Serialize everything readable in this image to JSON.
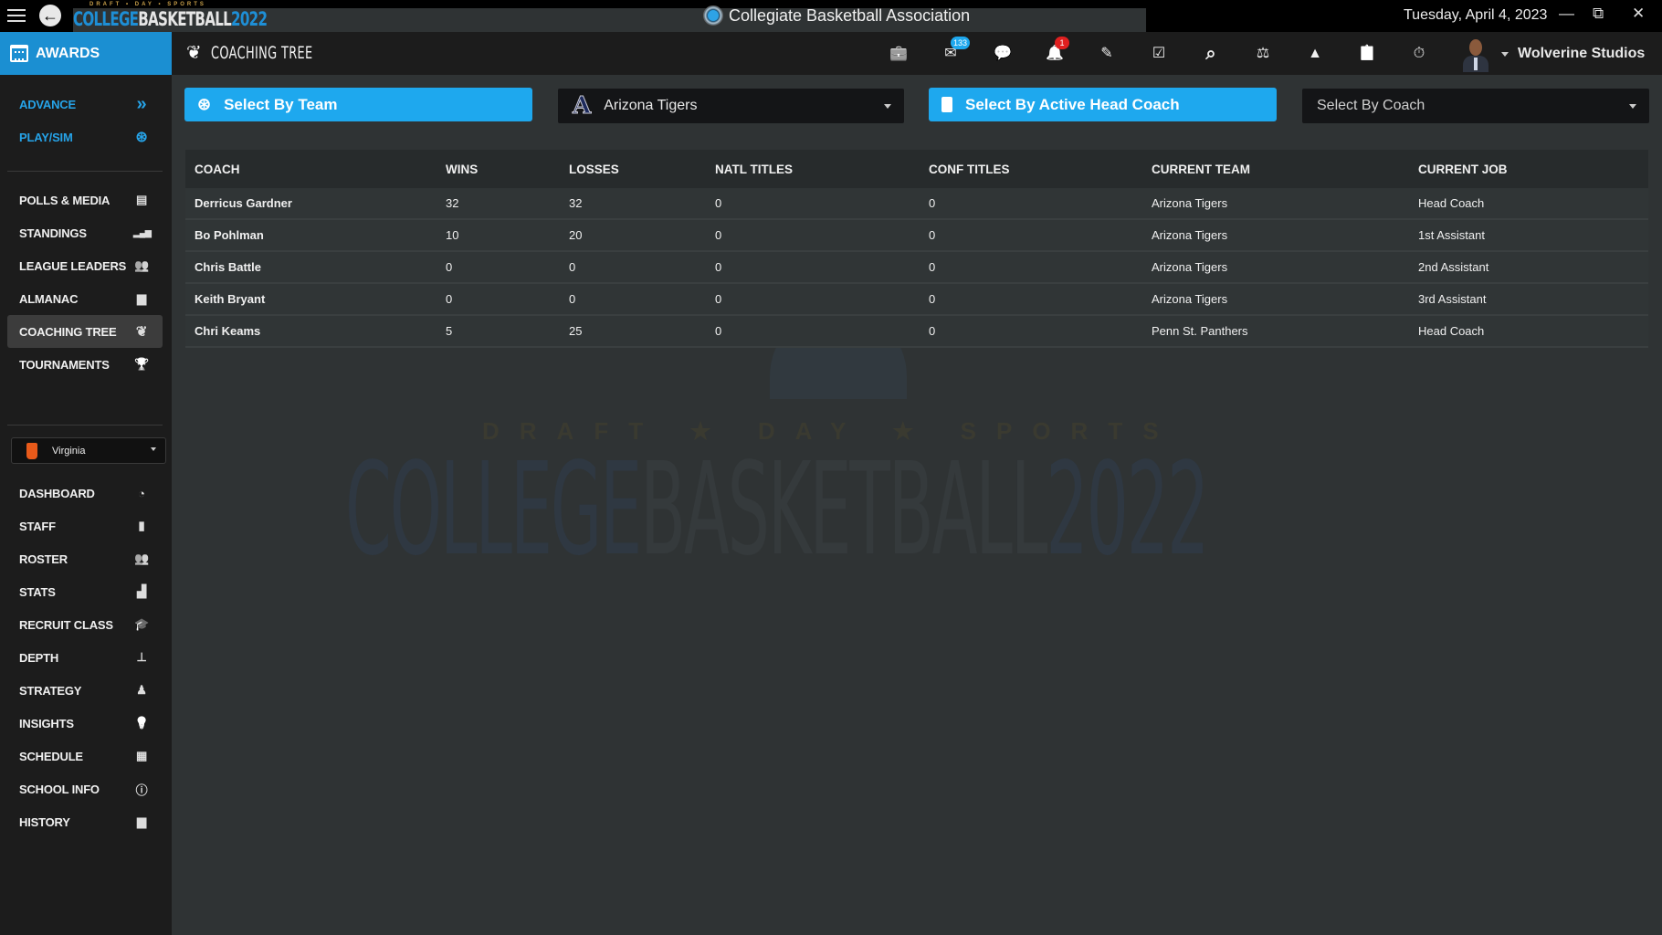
{
  "titlebar": {
    "logo_top": "DRAFT • DAY • SPORTS",
    "logo_college": "COLLEGE",
    "logo_basketball": "BASKETBALL",
    "logo_year": "2022",
    "app_title": "Collegiate Basketball Association",
    "date": "Tuesday, April 4, 2023",
    "minimize": "—",
    "restore": "⧉",
    "close": "✕"
  },
  "sidebar": {
    "awards_label": "AWARDS",
    "top_items": [
      {
        "label": "ADVANCE",
        "icon": "double-chevron-right-icon",
        "glyph": "»"
      },
      {
        "label": "PLAY/SIM",
        "icon": "basketball-icon",
        "glyph": "⊛"
      }
    ],
    "league_items": [
      {
        "label": "POLLS & MEDIA",
        "icon": "newspaper-icon",
        "glyph": "▤"
      },
      {
        "label": "STANDINGS",
        "icon": "signal-bars-icon",
        "glyph": "▂▄▆"
      },
      {
        "label": "LEAGUE LEADERS",
        "icon": "users-icon",
        "glyph": "👥"
      },
      {
        "label": "ALMANAC",
        "icon": "archive-icon",
        "glyph": "▆"
      },
      {
        "label": "COACHING TREE",
        "icon": "leaf-icon",
        "glyph": "❦",
        "active": true
      },
      {
        "label": "TOURNAMENTS",
        "icon": "trophy-icon",
        "glyph": "🏆"
      }
    ],
    "team_select": "Virginia",
    "team_items": [
      {
        "label": "DASHBOARD",
        "icon": "gauge-icon",
        "glyph": "◔"
      },
      {
        "label": "STAFF",
        "icon": "clipboard-icon",
        "glyph": "▮"
      },
      {
        "label": "ROSTER",
        "icon": "group-icon",
        "glyph": "👥"
      },
      {
        "label": "STATS",
        "icon": "bar-chart-icon",
        "glyph": "▟"
      },
      {
        "label": "RECRUIT CLASS",
        "icon": "graduate-icon",
        "glyph": "🎓"
      },
      {
        "label": "DEPTH",
        "icon": "sitemap-icon",
        "glyph": "⊥"
      },
      {
        "label": "STRATEGY",
        "icon": "chess-icon",
        "glyph": "♟"
      },
      {
        "label": "INSIGHTS",
        "icon": "lightbulb-icon",
        "glyph": "💡"
      },
      {
        "label": "SCHEDULE",
        "icon": "calendar-icon",
        "glyph": "▦"
      },
      {
        "label": "SCHOOL INFO",
        "icon": "info-icon",
        "glyph": "ⓘ"
      },
      {
        "label": "HISTORY",
        "icon": "archive-icon",
        "glyph": "▆"
      }
    ]
  },
  "topbar": {
    "page_title": "COACHING TREE",
    "icons": [
      {
        "name": "briefcase-icon",
        "glyph": "💼"
      },
      {
        "name": "mail-icon",
        "glyph": "✉",
        "badge": "133",
        "badge_color": "#1ea8ee"
      },
      {
        "name": "chat-icon",
        "glyph": "💬"
      },
      {
        "name": "bell-icon",
        "glyph": "🔔",
        "badge": "1",
        "badge_color": "#e02020"
      },
      {
        "name": "edit-icon",
        "glyph": "✎"
      },
      {
        "name": "calendar-check-icon",
        "glyph": "☑"
      },
      {
        "name": "search-icon",
        "glyph": "⌕"
      },
      {
        "name": "balance-scale-icon",
        "glyph": "⚖"
      },
      {
        "name": "road-icon",
        "glyph": "▲"
      },
      {
        "name": "clipboard-list-icon",
        "glyph": "📋"
      },
      {
        "name": "stopwatch-icon",
        "glyph": "⏱"
      }
    ],
    "user_name": "Wolverine Studios"
  },
  "filters": {
    "by_team_label": "Select By Team",
    "team_value": "Arizona Tigers",
    "by_coach_label": "Select By Active Head Coach",
    "coach_placeholder": "Select By Coach"
  },
  "table": {
    "headers": [
      "COACH",
      "WINS",
      "LOSSES",
      "NATL TITLES",
      "CONF TITLES",
      "CURRENT TEAM",
      "CURRENT JOB"
    ],
    "rows": [
      [
        "Derricus Gardner",
        "32",
        "32",
        "0",
        "0",
        "Arizona Tigers",
        "Head Coach"
      ],
      [
        "Bo Pohlman",
        "10",
        "20",
        "0",
        "0",
        "Arizona Tigers",
        "1st Assistant"
      ],
      [
        "Chris Battle",
        "0",
        "0",
        "0",
        "0",
        "Arizona Tigers",
        "2nd Assistant"
      ],
      [
        "Keith Bryant",
        "0",
        "0",
        "0",
        "0",
        "Arizona Tigers",
        "3rd Assistant"
      ],
      [
        "Chri Keams",
        "5",
        "25",
        "0",
        "0",
        "Penn St. Panthers",
        "Head Coach"
      ]
    ]
  },
  "watermark": {
    "top": "DRAFT ★ DAY ★ SPORTS",
    "college": "COLLEGE",
    "basketball": "BASKETBALL",
    "year": "2022"
  }
}
